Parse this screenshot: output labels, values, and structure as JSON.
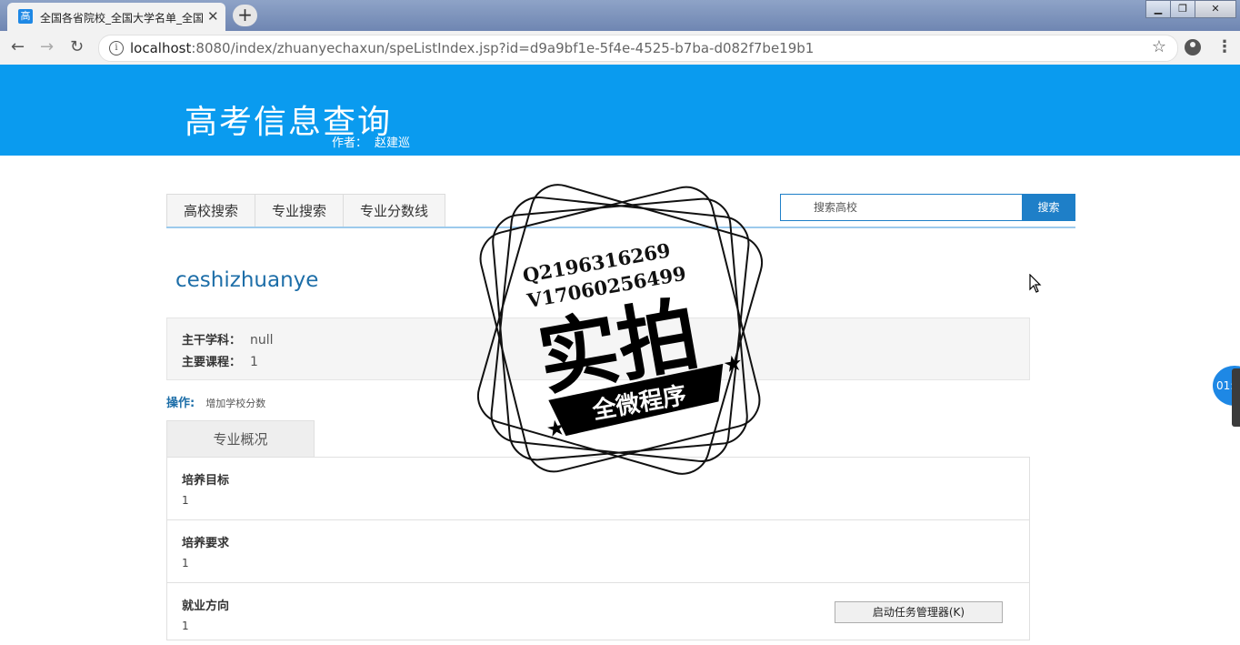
{
  "browser": {
    "tab_title": "全国各省院校_全国大学名单_全国",
    "favicon_char": "高",
    "url_host": "localhost",
    "url_rest": ":8080/index/zhuanyechaxun/speListIndex.jsp?id=d9a9bf1e-5f4e-4525-b7ba-d082f7be19b1"
  },
  "header": {
    "site_title": "高考信息查询",
    "author_label": "作者：",
    "author_name": "赵建巡"
  },
  "nav": {
    "tabs": [
      "高校搜索",
      "专业搜索",
      "专业分数线"
    ],
    "search_placeholder": "搜索高校",
    "search_button": "搜索"
  },
  "major": {
    "name": "ceshizhuanye",
    "fields": [
      {
        "label": "主干学科：",
        "value": "null"
      },
      {
        "label": "主要课程：",
        "value": "1"
      }
    ],
    "ops_label": "操作:",
    "ops_link": "增加学校分数"
  },
  "overview": {
    "tab_label": "专业概况",
    "items": [
      {
        "title": "培养目标",
        "text": "1"
      },
      {
        "title": "培养要求",
        "text": "1"
      },
      {
        "title": "就业方向",
        "text": "1"
      }
    ]
  },
  "taskbar": {
    "task_manager_label": "启动任务管理器(K)"
  },
  "watermark": {
    "line1": "Q2196316269",
    "line2": "V17060256499",
    "big": "实拍",
    "ribbon": "全微程序"
  },
  "timer_badge": "01:"
}
